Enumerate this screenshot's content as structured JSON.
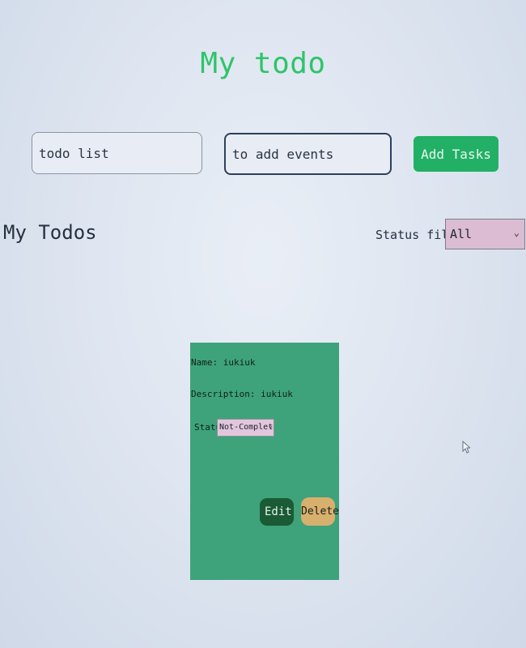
{
  "header": {
    "title": "My todo"
  },
  "form": {
    "name_value": "todo list",
    "description_value": "to add events",
    "add_label": "Add Tasks"
  },
  "list": {
    "title": "My Todos",
    "filter_label": "Status filter",
    "filter_value": "All"
  },
  "todo": {
    "name_line": "Name: iukiuk",
    "description_line": "Description: iukiuk",
    "status_label": "Status",
    "status_value": "Not-Completed",
    "edit_label": "Edit",
    "delete_label": "Delete"
  },
  "colors": {
    "title": "#2fc46a",
    "add_button": "#22b066",
    "card": "#3ea37a",
    "edit_button": "#1a5a35",
    "delete_button": "#d7b06d",
    "select_bg": "#dcbcd2"
  },
  "icons": {
    "dropdown": "chevron-down-icon",
    "pointer": "mouse-cursor-icon"
  }
}
